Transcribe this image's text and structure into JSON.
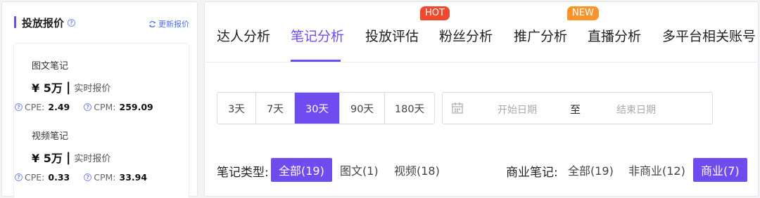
{
  "pricing": {
    "title": "投放报价",
    "refresh_label": "更新报价",
    "notes": [
      {
        "type": "图文笔记",
        "price": "¥ 5万",
        "separator": "|",
        "realtime": "实时报价",
        "cpe_label": "CPE:",
        "cpe_value": "2.49",
        "cpm_label": "CPM:",
        "cpm_value": "259.09"
      },
      {
        "type": "视频笔记",
        "price": "¥ 5万",
        "separator": "|",
        "realtime": "实时报价",
        "cpe_label": "CPE:",
        "cpe_value": "0.33",
        "cpm_label": "CPM:",
        "cpm_value": "33.94"
      }
    ]
  },
  "tabs": [
    {
      "label": "达人分析"
    },
    {
      "label": "笔记分析",
      "active": true
    },
    {
      "label": "投放评估"
    },
    {
      "label": "粉丝分析",
      "badge": "HOT"
    },
    {
      "label": "推广分析"
    },
    {
      "label": "直播分析",
      "badge": "NEW"
    },
    {
      "label": "多平台相关账号"
    }
  ],
  "periods": [
    {
      "label": "3天"
    },
    {
      "label": "7天"
    },
    {
      "label": "30天",
      "active": true
    },
    {
      "label": "90天"
    },
    {
      "label": "180天"
    }
  ],
  "date_range": {
    "start_placeholder": "开始日期",
    "separator": "至",
    "end_placeholder": "结束日期"
  },
  "note_type_filter": {
    "label": "笔记类型:",
    "options": [
      {
        "label": "全部(19)",
        "active": true
      },
      {
        "label": "图文(1)"
      },
      {
        "label": "视频(18)"
      }
    ]
  },
  "commercial_filter": {
    "label": "商业笔记:",
    "options": [
      {
        "label": "全部(19)"
      },
      {
        "label": "非商业(12)"
      },
      {
        "label": "商业(7)",
        "active": true
      }
    ]
  },
  "colors": {
    "accent": "#6f4cf0",
    "hot": "#f04a2e",
    "new": "#f7942a",
    "link": "#4a6ff0"
  },
  "icons": [
    "help-icon",
    "refresh-icon",
    "calendar-icon"
  ]
}
